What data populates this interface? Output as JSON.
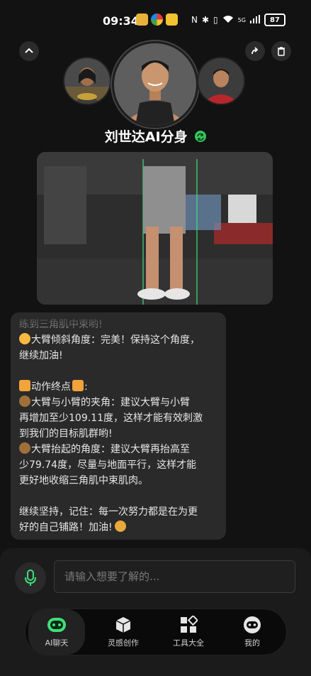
{
  "status": {
    "time": "09:34",
    "battery": "87",
    "network": "5G"
  },
  "profile": {
    "name": "刘世达AI分身"
  },
  "message": {
    "lines": [
      "练到三角肌中束哟!",
      "大臂倾斜角度：完美！保持这个角度，",
      "继续加油!",
      "",
      "动作终点",
      "大臂与小臂的夹角：建议大臂与小臂",
      "再增加至少109.11度，这样才能有效刺激",
      "到我们的目标肌群哟!",
      "大臂抬起的角度：建议大臂再抬高至",
      "少79.74度，尽量与地面平行，这样才能",
      "更好地收缩三角肌中束肌肉。",
      "",
      "继续坚持，记住：每一次努力都是在为更",
      "好的自己铺路！加油!"
    ]
  },
  "input": {
    "placeholder": "请输入想要了解的..."
  },
  "tabs": [
    {
      "label": "AI聊天",
      "icon": "robot-face-icon"
    },
    {
      "label": "灵感创作",
      "icon": "cube-icon"
    },
    {
      "label": "工具大全",
      "icon": "grid-tools-icon"
    },
    {
      "label": "我的",
      "icon": "profile-face-icon"
    }
  ],
  "colors": {
    "accent": "#34c759",
    "background": "#121212",
    "bubble": "#2a2a2a"
  }
}
